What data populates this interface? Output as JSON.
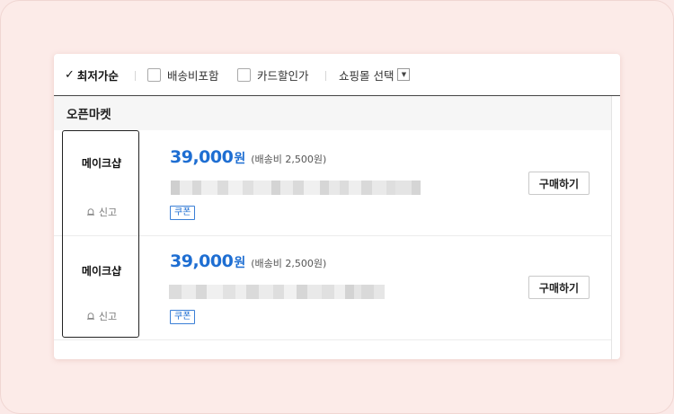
{
  "filters": {
    "sort_label": "최저가순",
    "shipping_label": "배송비포함",
    "card_discount_label": "카드할인가",
    "mall_select_label": "쇼핑몰 선택"
  },
  "section": {
    "title": "오픈마켓"
  },
  "offers": [
    {
      "seller": "메이크샵",
      "report_label": "신고",
      "price": "39,000",
      "currency": "원",
      "shipping": "(배송비 2,500원)",
      "coupon": "쿠폰",
      "buy_label": "구매하기"
    },
    {
      "seller": "메이크샵",
      "report_label": "신고",
      "price": "39,000",
      "currency": "원",
      "shipping": "(배송비 2,500원)",
      "coupon": "쿠폰",
      "buy_label": "구매하기"
    }
  ],
  "colors": {
    "accent": "#1e6ed2",
    "background": "#fbe9e7"
  }
}
